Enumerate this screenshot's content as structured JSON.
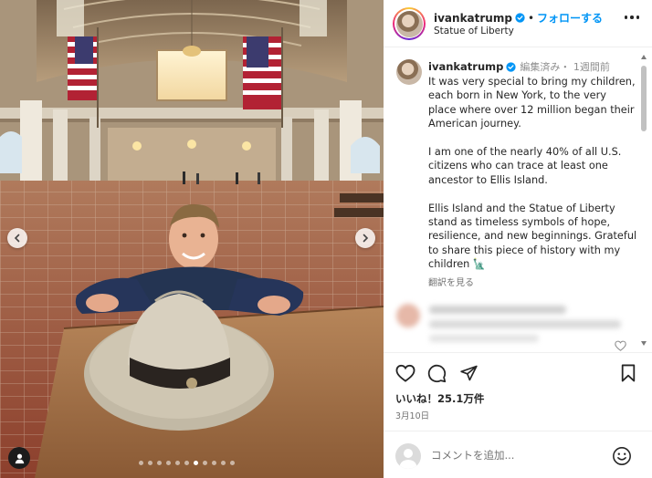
{
  "post": {
    "username": "ivankatrump",
    "follow_label": "フォローする",
    "separator": "•",
    "location": "Statue of Liberty"
  },
  "caption": {
    "username": "ivankatrump",
    "meta": "編集済み・ 1週間前",
    "text": "It was very special to bring my children,\neach born in New York, to the very\nplace where over 12 million began their\nAmerican journey.\n\nI am one of the nearly 40% of all U.S.\ncitizens who can trace at least one\nancestor to Ellis Island.\n\nEllis Island and the Statue of Liberty\nstand as timeless symbols of hope,\nresilience, and new beginnings. Grateful\nto share this piece of history with my\nchildren 🗽",
    "translate_label": "翻訳を見る"
  },
  "stats": {
    "likes": "いいね！25.1万件",
    "date": "3月10日"
  },
  "comment_box": {
    "placeholder": "コメントを追加..."
  },
  "carousel": {
    "slide_count": 11,
    "active_index": 6
  },
  "icons": {
    "verified": "verified-badge-icon",
    "more": "more-options-icon",
    "like": "heart-icon",
    "comment": "comment-icon",
    "share": "send-icon",
    "save": "bookmark-icon",
    "emoji": "emoji-icon",
    "prev": "chevron-left-icon",
    "next": "chevron-right-icon",
    "tagged_users": "user-tag-icon"
  },
  "colors": {
    "link_blue": "#0095f6",
    "verified_blue": "#0095f6",
    "text": "#262626",
    "muted": "#737373"
  }
}
